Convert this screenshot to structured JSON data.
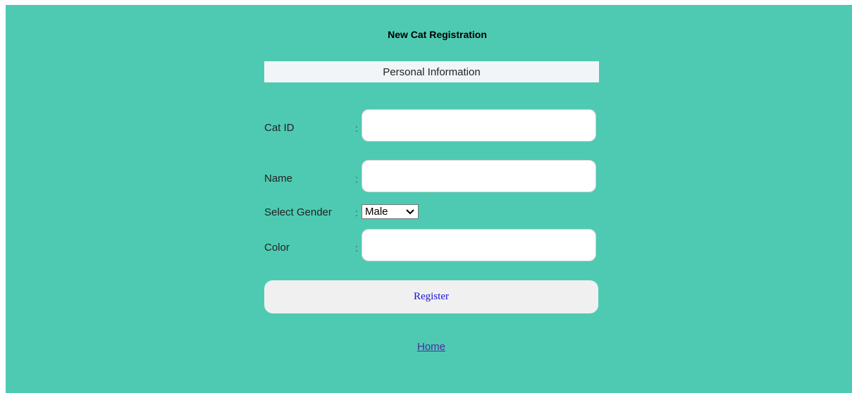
{
  "form": {
    "title": "New Cat Registration",
    "section_title": "Personal Information",
    "separator": ":",
    "fields": {
      "cat_id": {
        "label": "Cat ID",
        "value": ""
      },
      "name": {
        "label": "Name",
        "value": ""
      },
      "gender": {
        "label": "Select Gender",
        "selected": "Male"
      },
      "color": {
        "label": "Color",
        "value": ""
      }
    },
    "register_label": "Register",
    "home_link": "Home"
  },
  "colors": {
    "background": "#4ecab2",
    "section_bar": "#f2f5f7",
    "button": "#f0f0f0",
    "button_text": "#1a10d6",
    "link": "#4b2aa0"
  },
  "icons": {
    "select_arrow": "chevron-down-icon"
  }
}
